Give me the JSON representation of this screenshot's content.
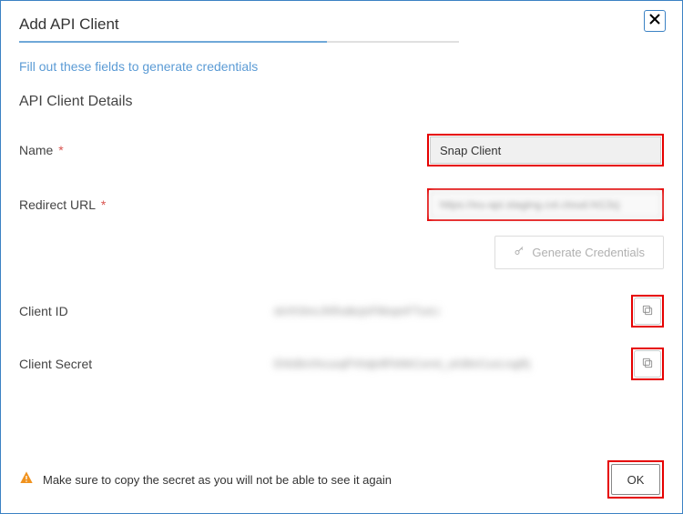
{
  "dialog": {
    "title": "Add API Client",
    "subtitle": "Fill out these fields to generate credentials",
    "section_title": "API Client Details"
  },
  "fields": {
    "name_label": "Name",
    "name_value": "Snap Client",
    "redirect_label": "Redirect URL",
    "redirect_value": "https://eu-api.staging.cxt.cloud.ht13zj"
  },
  "actions": {
    "generate_label": "Generate Credentials"
  },
  "outputs": {
    "client_id_label": "Client ID",
    "client_id_value": "dxVh3mcJhRxdkzjnFMxqmFTuvLi",
    "client_secret_label": "Client Secret",
    "client_secret_value": "EhfzBxVhcuxqPVhdjnfIFkNhCxrmt_uh3thrCuvLrxgRj"
  },
  "footer": {
    "warning": "Make sure to copy the secret as you will not be able to see it again",
    "ok_label": "OK"
  }
}
